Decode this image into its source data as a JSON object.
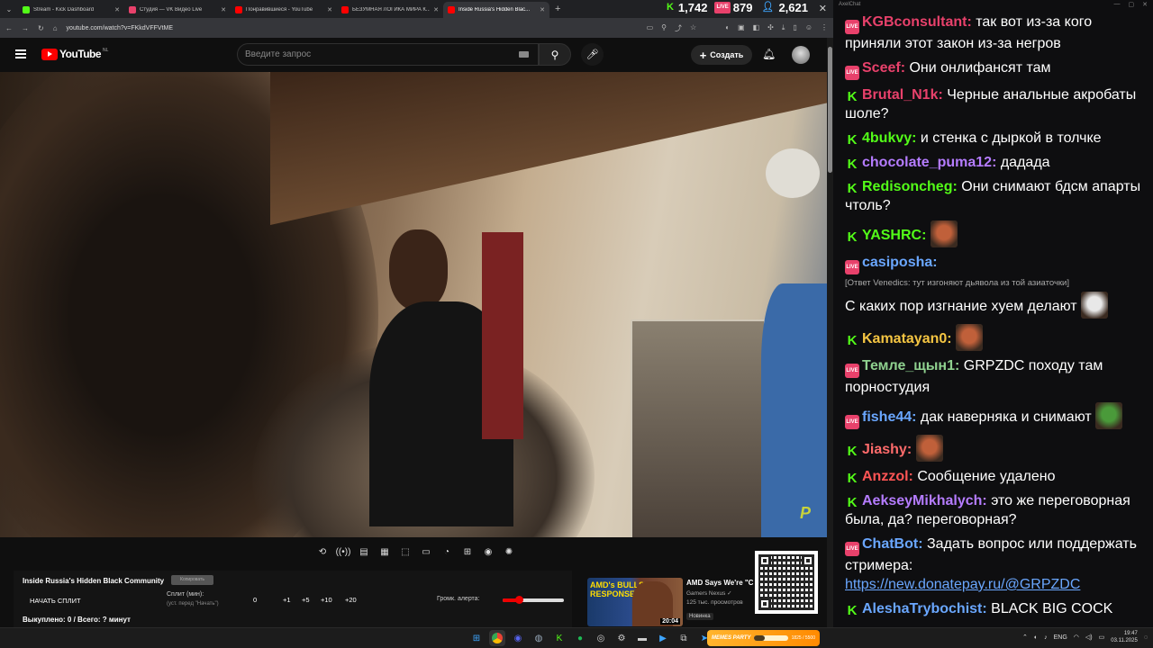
{
  "browser": {
    "tabs": [
      {
        "title": "Stream - Kick Dashboard",
        "color": "#53fc18",
        "active": false
      },
      {
        "title": "Студия — VK Видео Live",
        "color": "#e8416b",
        "active": false
      },
      {
        "title": "Понравившиеся - YouTube",
        "color": "#ff0000",
        "active": false
      },
      {
        "title": "БЕЗУМНАЯ ЛОГИКА МИРА К...",
        "color": "#ff0000",
        "active": false
      },
      {
        "title": "Inside Russia's Hidden Blac...",
        "color": "#ff0000",
        "active": true
      }
    ],
    "new_tab": "+",
    "url": "youtube.com/watch?v=FKkdVFFVtME",
    "counters": [
      {
        "icon": "K",
        "value": "1,742",
        "color": "#53fc18"
      },
      {
        "icon": "LIVE",
        "value": "879",
        "color": "#e8416b"
      },
      {
        "icon": "user",
        "value": "2,621",
        "color": "#3ea6ff"
      }
    ]
  },
  "youtube": {
    "logo_text": "YouTube",
    "region": "NL",
    "search_placeholder": "Введите запрос",
    "create_label": "Создать"
  },
  "split": {
    "title": "Inside Russia's Hidden Black Community",
    "copy_label": "Копировать",
    "start_label": "НАЧАТЬ СПЛИТ",
    "split_min_label": "Сплит (мин):",
    "split_hint": "(уст. перед \"Начать\")",
    "value": "0",
    "increments": [
      "+1",
      "+5",
      "+10",
      "+20"
    ],
    "volume_label": "Громк. алерта:",
    "volume_fraction": 0.27,
    "killed": "Выкуплено: 0 / Всего: ? минут"
  },
  "recommended": {
    "thumb_text": "AMD's BULLSH RESPONSE",
    "duration": "20:04",
    "title": "AMD Says We're \"C",
    "channel": "Gamers Nexus",
    "views": "125 тыс. просмотров",
    "badge": "Новинка"
  },
  "watermark": "P",
  "chat": {
    "app_title": "AxelChat",
    "messages": [
      {
        "platform": "vk",
        "user": "KGBconsultant",
        "color": "#e8416b",
        "text": "так вот из-за кого приняли этот закон из-за негров"
      },
      {
        "platform": "vk",
        "user": "Sceef",
        "color": "#e8416b",
        "text": "Они онлифансят там"
      },
      {
        "platform": "kick",
        "user": "Brutal_N1k",
        "color": "#e8416b",
        "text": "Черные анальные акробаты шоле?"
      },
      {
        "platform": "kick",
        "user": "4bukvy",
        "color": "#53fc18",
        "text": "и стенка с дыркой в толчке"
      },
      {
        "platform": "kick",
        "user": "chocolate_puma12",
        "color": "#b57cff",
        "text": "дадада"
      },
      {
        "platform": "kick",
        "user": "Redisoncheg",
        "color": "#53fc18",
        "text": "Они снимают бдсм апарты чтоль?"
      },
      {
        "platform": "kick",
        "user": "YASHRC",
        "color": "#53fc18",
        "text": "",
        "emote": "#c0603a"
      },
      {
        "platform": "vk",
        "user": "casiposha",
        "color": "#6aa7ff",
        "text": "С каких пор изгнание хуем делают",
        "reply": "[Ответ Venedics: тут изгоняют дьявола из той азиаточки]",
        "emote": "#e8e8e8"
      },
      {
        "platform": "kick",
        "user": "Kamatayan0",
        "color": "#f5c542",
        "text": "",
        "emote": "#c0603a"
      },
      {
        "platform": "vk",
        "user": "Темле_щын1",
        "color": "#8fd18f",
        "text": "GRPZDC походу там порностудия"
      },
      {
        "platform": "vk",
        "user": "fishe44",
        "color": "#6aa7ff",
        "text": "дак наверняка и снимают",
        "emote": "#4a9a3a"
      },
      {
        "platform": "kick",
        "user": "Jiashy",
        "color": "#ff6b6b",
        "text": "",
        "emote": "#c0603a"
      },
      {
        "platform": "kick",
        "user": "Anzzol",
        "color": "#ff5555",
        "text": "Сообщение удалено"
      },
      {
        "platform": "kick",
        "user": "AekseyMikhalych",
        "color": "#b57cff",
        "text": "это же переговорная была, да? переговорная?"
      },
      {
        "platform": "vk",
        "user": "ChatBot",
        "color": "#6aa7ff",
        "text": "Задать вопрос или поддержать стримера:",
        "link": "https://new.donatepay.ru/@GRPZDC"
      },
      {
        "platform": "kick",
        "user": "AleshaTrybochist",
        "color": "#6aa7ff",
        "text": "BLACK BIG COCK"
      }
    ]
  },
  "taskbar": {
    "meme_label": "MEMES PARTY",
    "meme_progress": "1825 / 5500",
    "lang": "ENG",
    "time": "19:47",
    "date": "03.11.2025"
  }
}
